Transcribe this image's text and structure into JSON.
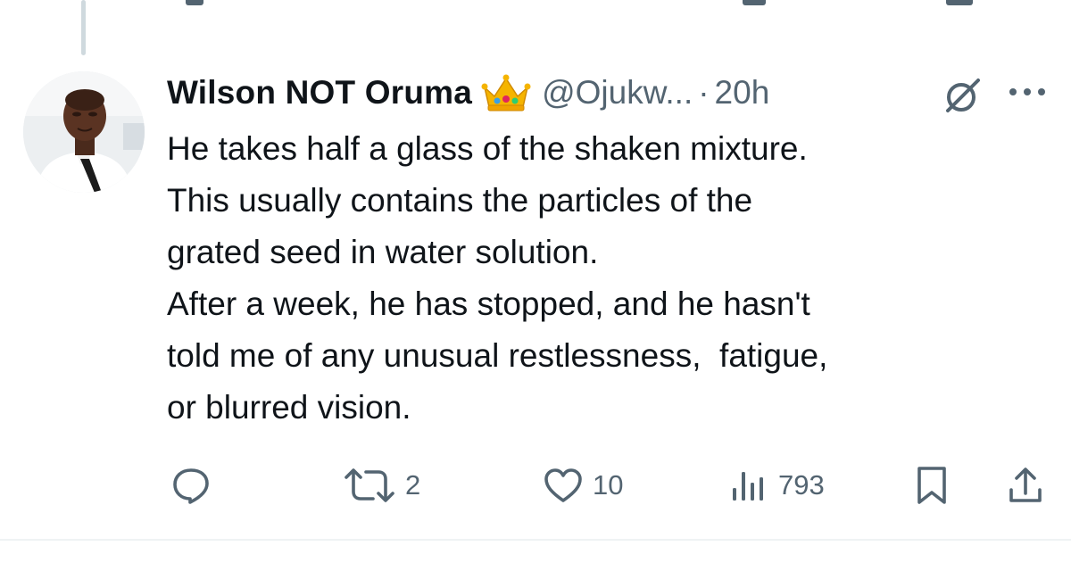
{
  "tweet": {
    "author_name": "Wilson NOT Oruma",
    "badge_icon": "crown-emoji",
    "handle": "@Ojukw...",
    "separator": "·",
    "time": "20h",
    "text_lines": [
      "He takes half a glass of the shaken mixture.",
      "This usually contains the particles of the",
      "grated seed in water solution.",
      "After a week, he has stopped, and he hasn't",
      "told me of any unusual restlessness,  fatigue,",
      "or blurred vision."
    ]
  },
  "actions": {
    "reply_icon": "reply-icon",
    "retweet_icon": "retweet-icon",
    "retweet_count": "2",
    "like_icon": "heart-icon",
    "like_count": "10",
    "views_icon": "views-icon",
    "views_count": "793",
    "bookmark_icon": "bookmark-icon",
    "share_icon": "share-icon"
  },
  "colors": {
    "text": "#0f1419",
    "secondary": "#536471",
    "divider": "#eff3f4",
    "thread_line": "#cfd9de"
  }
}
